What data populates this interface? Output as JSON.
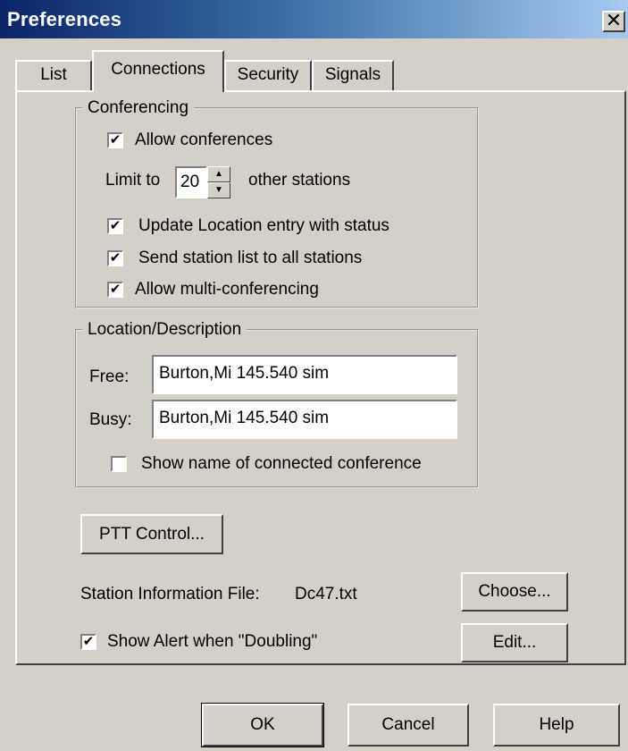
{
  "window": {
    "title": "Preferences",
    "close_glyph": "✕"
  },
  "tabs": [
    {
      "label": "List"
    },
    {
      "label": "Connections"
    },
    {
      "label": "Security"
    },
    {
      "label": "Signals"
    }
  ],
  "conferencing": {
    "legend": "Conferencing",
    "allow_conferences": {
      "label": "Allow conferences",
      "checked": true
    },
    "limit_prefix": "Limit to",
    "limit_value": "20",
    "limit_suffix": "other stations",
    "update_location": {
      "label": "Update Location entry with status",
      "checked": true
    },
    "send_station_list": {
      "label": "Send station list to all stations",
      "checked": true
    },
    "allow_multi": {
      "label": "Allow multi-conferencing",
      "checked": true
    }
  },
  "location": {
    "legend": "Location/Description",
    "free_label": "Free:",
    "free_value": "Burton,Mi 145.540 sim",
    "busy_label": "Busy:",
    "busy_value": "Burton,Mi 145.540 sim",
    "show_name": {
      "label": "Show name of connected conference",
      "checked": false
    }
  },
  "ptt_button": "PTT Control...",
  "station_info": {
    "label": "Station Information File:",
    "file": "Dc47.txt",
    "choose_button": "Choose..."
  },
  "doubling": {
    "label": "Show Alert when \"Doubling\"",
    "checked": true,
    "edit_button": "Edit..."
  },
  "footer": {
    "ok": "OK",
    "cancel": "Cancel",
    "help": "Help"
  },
  "check_glyph": "✔"
}
